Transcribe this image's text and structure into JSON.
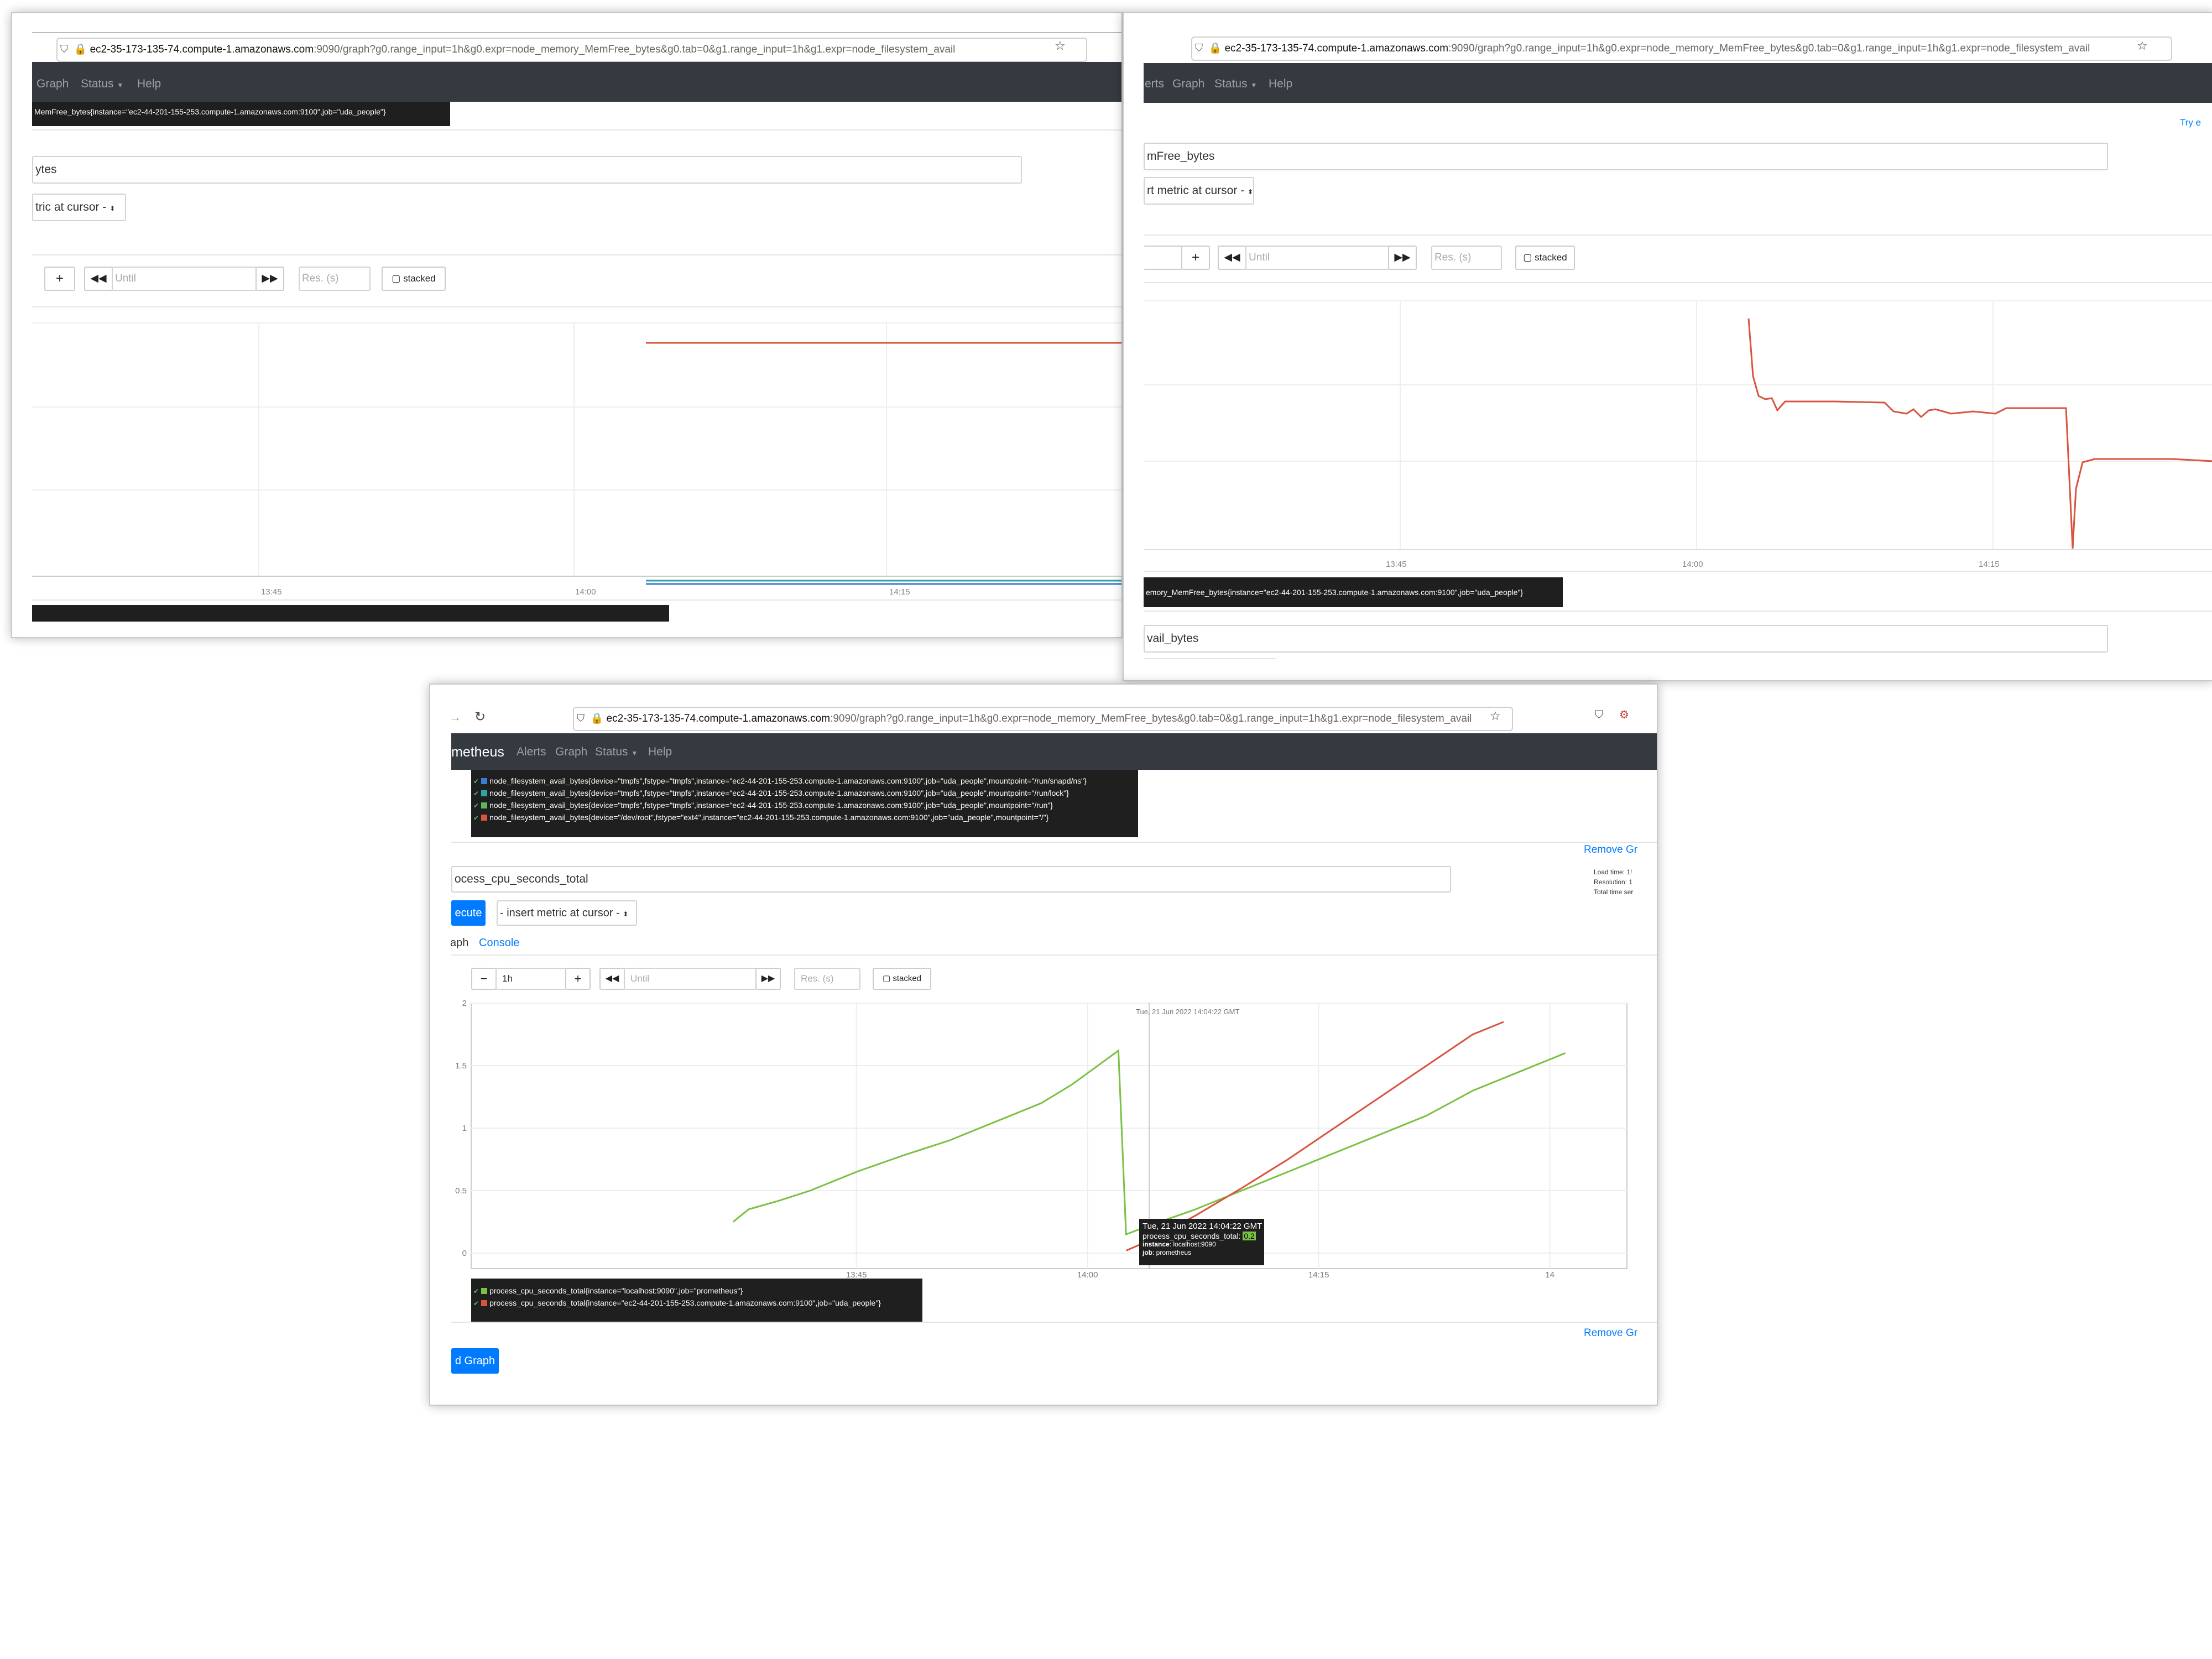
{
  "browser": {
    "url_host": "ec2-35-173-135-74.compute-1.amazonaws.com",
    "url_rest": ":9090/graph?g0.range_input=1h&g0.expr=node_memory_MemFree_bytes&g0.tab=0&g1.range_input=1h&g1.expr=node_filesystem_avail"
  },
  "nav": {
    "brand_fragment": "metheus",
    "alerts": "Alerts",
    "alerts_fragment": "erts",
    "graph": "Graph",
    "status": "Status",
    "help": "Help"
  },
  "controls": {
    "until_placeholder": "Until",
    "res_placeholder": "Res. (s)",
    "stacked": "stacked",
    "range_value": "1h",
    "plus": "+",
    "minus": "−"
  },
  "shot1": {
    "tooltip_text": "MemFree_bytes{instance=\"ec2-44-201-155-253.compute-1.amazonaws.com:9100\",job=\"uda_people\"}",
    "expr_fragment": "ytes",
    "insert_fragment": "tric at cursor -",
    "x_ticks": [
      "13:45",
      "14:00",
      "14:15"
    ],
    "line_colors": [
      "#d9543e",
      "#2aa7a4",
      "#3b7bd6"
    ]
  },
  "shot2": {
    "try_text": "Try e",
    "expr_fragment": "mFree_bytes",
    "insert_fragment": "rt metric at cursor -",
    "x_ticks": [
      "13:45",
      "14:00",
      "14:15"
    ],
    "legend_text": "emory_MemFree_bytes{instance=\"ec2-44-201-155-253.compute-1.amazonaws.com:9100\",job=\"uda_people\"}",
    "expr2_fragment": "vail_bytes",
    "line_color": "#d9543e"
  },
  "shot3": {
    "fs_legend": [
      {
        "color": "#3b7bd6",
        "text": "node_filesystem_avail_bytes{device=\"tmpfs\",fstype=\"tmpfs\",instance=\"ec2-44-201-155-253.compute-1.amazonaws.com:9100\",job=\"uda_people\",mountpoint=\"/run/snapd/ns\"}"
      },
      {
        "color": "#2aa7a4",
        "text": "node_filesystem_avail_bytes{device=\"tmpfs\",fstype=\"tmpfs\",instance=\"ec2-44-201-155-253.compute-1.amazonaws.com:9100\",job=\"uda_people\",mountpoint=\"/run/lock\"}"
      },
      {
        "color": "#5cb85c",
        "text": "node_filesystem_avail_bytes{device=\"tmpfs\",fstype=\"tmpfs\",instance=\"ec2-44-201-155-253.compute-1.amazonaws.com:9100\",job=\"uda_people\",mountpoint=\"/run\"}"
      },
      {
        "color": "#d9543e",
        "text": "node_filesystem_avail_bytes{device=\"/dev/root\",fstype=\"ext4\",instance=\"ec2-44-201-155-253.compute-1.amazonaws.com:9100\",job=\"uda_people\",mountpoint=\"/\"}"
      }
    ],
    "remove_graph": "Remove Gr",
    "expr_fragment": "ocess_cpu_seconds_total",
    "execute_fragment": "ecute",
    "insert_metric": "- insert metric at cursor -",
    "load_time": "Load time: 1!",
    "resolution": "Resolution: 1",
    "total_time": "Total time ser",
    "tab_graph_fragment": "aph",
    "tab_console": "Console",
    "add_graph_fragment": "d Graph",
    "cpu_legend": [
      {
        "color": "#7ac143",
        "text": "process_cpu_seconds_total{instance=\"localhost:9090\",job=\"prometheus\"}"
      },
      {
        "color": "#d9543e",
        "text": "process_cpu_seconds_total{instance=\"ec2-44-201-155-253.compute-1.amazonaws.com:9100\",job=\"uda_people\"}"
      }
    ],
    "hover_time": "Tue, 21 Jun 2022 14:04:22 GMT",
    "hover_tooltip": {
      "time": "Tue, 21 Jun 2022 14:04:22 GMT",
      "metric_line": "process_cpu_seconds_total:",
      "metric_value": "0.2",
      "instance_label": "instance",
      "instance_value": ": localhost:9090",
      "job_label": "job",
      "job_value": ": prometheus"
    }
  },
  "chart_data": {
    "type": "line",
    "title": "",
    "xlabel": "",
    "ylabel": "",
    "x_ticks": [
      "13:45",
      "14:00",
      "14:15",
      "14"
    ],
    "y_ticks": [
      "0",
      "0.5",
      "1",
      "1.5",
      "2"
    ],
    "ylim": [
      0,
      2
    ],
    "grid": true,
    "legend_position": "bottom",
    "series": [
      {
        "name": "process_cpu_seconds_total{instance=\"localhost:9090\",job=\"prometheus\"}",
        "color": "#7ac143",
        "points": [
          [
            "13:37",
            0.25
          ],
          [
            "13:38",
            0.35
          ],
          [
            "13:40",
            0.42
          ],
          [
            "13:42",
            0.5
          ],
          [
            "13:45",
            0.65
          ],
          [
            "13:48",
            0.78
          ],
          [
            "13:51",
            0.9
          ],
          [
            "13:54",
            1.05
          ],
          [
            "13:57",
            1.2
          ],
          [
            "13:59",
            1.35
          ],
          [
            "14:02",
            1.62
          ],
          [
            "14:02:30",
            0.15
          ],
          [
            "14:04",
            0.22
          ],
          [
            "14:07",
            0.35
          ],
          [
            "14:10",
            0.5
          ],
          [
            "14:13",
            0.65
          ],
          [
            "14:16",
            0.8
          ],
          [
            "14:19",
            0.95
          ],
          [
            "14:22",
            1.1
          ],
          [
            "14:25",
            1.3
          ],
          [
            "14:28",
            1.45
          ],
          [
            "14:31",
            1.6
          ]
        ]
      },
      {
        "name": "process_cpu_seconds_total{instance=\"ec2-44-201-155-253.compute-1.amazonaws.com:9100\",job=\"uda_people\"}",
        "color": "#d9543e",
        "points": [
          [
            "14:02:30",
            0.02
          ],
          [
            "14:04",
            0.1
          ],
          [
            "14:07",
            0.3
          ],
          [
            "14:10",
            0.52
          ],
          [
            "14:13",
            0.75
          ],
          [
            "14:16",
            1.0
          ],
          [
            "14:19",
            1.25
          ],
          [
            "14:22",
            1.5
          ],
          [
            "14:25",
            1.75
          ],
          [
            "14:27",
            1.85
          ]
        ]
      }
    ]
  }
}
